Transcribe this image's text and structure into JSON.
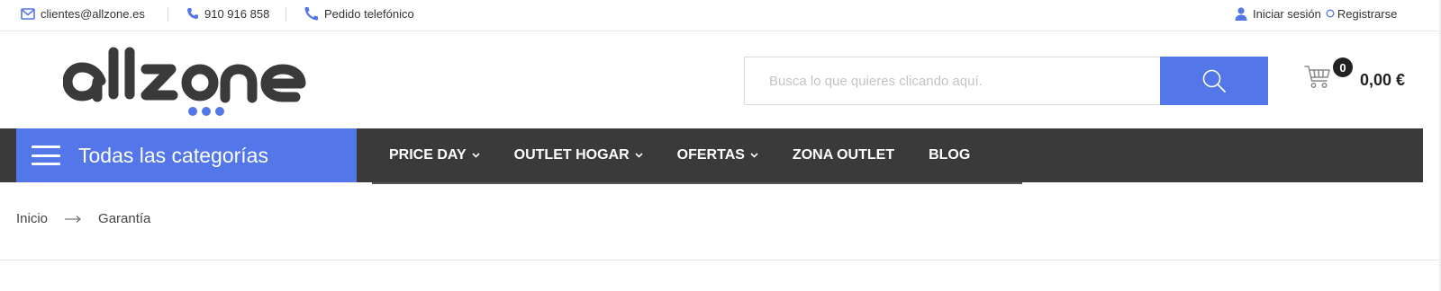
{
  "topbar": {
    "email": "clientes@allzone.es",
    "phone": "910 916 858",
    "phone_order": "Pedido telefónico",
    "login": "Iniciar sesión",
    "register": "Registrarse"
  },
  "brand": {
    "logo_text": "allzone",
    "accent_color": "#5377e8",
    "dark_color": "#3a3a3a"
  },
  "search": {
    "placeholder": "Busca lo que quieres clicando aquí.",
    "value": ""
  },
  "cart": {
    "count": "0",
    "total": "0,00 €"
  },
  "navbar": {
    "categories_label": "Todas las categorías",
    "items": [
      {
        "label": "PRICE DAY",
        "has_dropdown": true
      },
      {
        "label": "OUTLET HOGAR",
        "has_dropdown": true
      },
      {
        "label": "OFERTAS",
        "has_dropdown": true
      },
      {
        "label": "ZONA OUTLET",
        "has_dropdown": false
      },
      {
        "label": "BLOG",
        "has_dropdown": false
      }
    ]
  },
  "breadcrumb": {
    "home": "Inicio",
    "current": "Garantía"
  }
}
